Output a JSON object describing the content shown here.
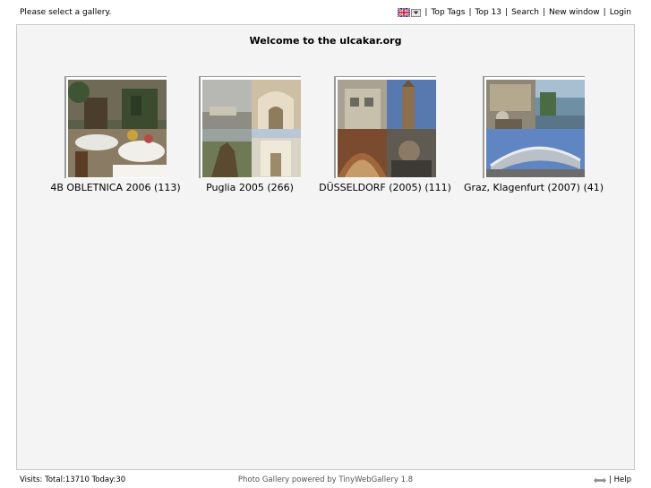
{
  "top": {
    "status": "Please select a gallery.",
    "nav": [
      "Top Tags",
      "Top 13",
      "Search",
      "New window",
      "Login"
    ],
    "separator": "|"
  },
  "main": {
    "welcome": "Welcome to the ulcakar.org",
    "galleries": [
      {
        "label": "4B OBLETNICA 2006 (113)"
      },
      {
        "label": "Puglia 2005 (266)"
      },
      {
        "label": "DÜSSELDORF (2005) (111)"
      },
      {
        "label": "Graz, Klagenfurt (2007) (41)"
      }
    ]
  },
  "footer": {
    "visits": "Visits: Total:13710 Today:30",
    "powered": "Photo Gallery powered by TinyWebGallery 1.8",
    "help": "| Help"
  },
  "icons": {
    "flag": "uk-flag-icon",
    "dropdown": "chevron-down-icon",
    "fullscreen": "fullscreen-icon"
  },
  "colors": {
    "panel_bg": "#f4f4f4",
    "panel_border": "#c8c8c8"
  }
}
